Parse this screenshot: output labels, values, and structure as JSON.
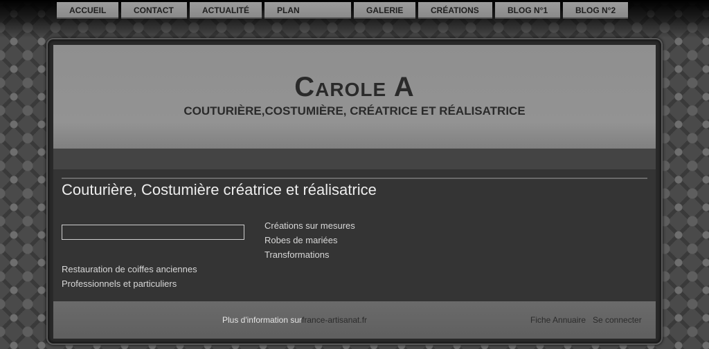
{
  "header": {
    "title": "Carole A",
    "subtitle": "COUTURIÈRE,COSTUMIÈRE, CRÉATRICE ET RÉALISATRICE"
  },
  "nav": {
    "items": [
      {
        "label": "ACCUEIL"
      },
      {
        "label": "CONTACT"
      },
      {
        "label": "ACTUALITÉ"
      },
      {
        "label": "PLAN"
      },
      {
        "label": "GALERIE"
      },
      {
        "label": "CRÉATIONS"
      },
      {
        "label": "BLOG N°1"
      },
      {
        "label": "BLOG N°2"
      }
    ]
  },
  "main": {
    "title": "Couturière, Costumière créatrice et réalisatrice",
    "search_value": "",
    "right_lines": [
      "Créations sur mesures",
      "Robes de mariées",
      "Transformations"
    ],
    "left_lines": [
      "Restauration de coiffes anciennes",
      "Professionnels et particuliers"
    ]
  },
  "footer": {
    "info_prefix": "Plus d'information sur",
    "info_link": "france-artisanat.fr",
    "fiche_label": "Fiche Annuaire",
    "login_label": "Se connecter"
  }
}
